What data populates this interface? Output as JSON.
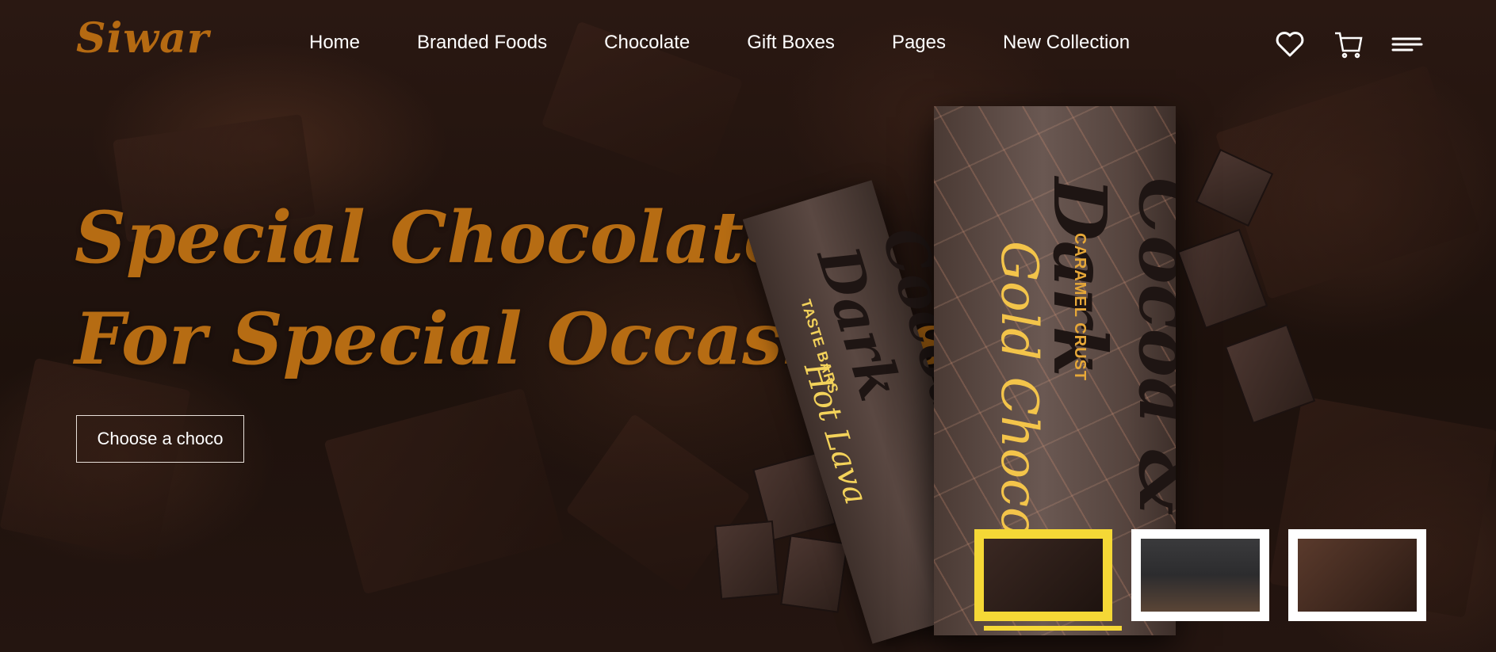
{
  "header": {
    "logo": "Siwar",
    "nav": [
      "Home",
      "Branded Foods",
      "Chocolate",
      "Gift Boxes",
      "Pages",
      "New Collection"
    ],
    "icons": [
      "heart-icon",
      "cart-icon",
      "menu-icon"
    ]
  },
  "hero": {
    "headline_line1": "Special Chocolate",
    "headline_line2": "For Special Occasions",
    "cta_label": "Choose a choco"
  },
  "product": {
    "small_bar": {
      "brand": "Cocoa & Dark",
      "tagline": "TASTE BARS",
      "flavor": "Hot Lava"
    },
    "big_bar": {
      "brand": "Cocoa & Dark",
      "tagline": "CARAMEL CRUST",
      "flavor": "Gold Choco"
    }
  },
  "thumbnails": {
    "active_index": 0,
    "items": [
      "chocolate-bar-thumb",
      "cupcake-thumb",
      "chocolate-stack-thumb"
    ]
  },
  "colors": {
    "accent_gold": "#b56a12",
    "active_thumb": "#f5d836",
    "text_light": "#ffffff"
  }
}
